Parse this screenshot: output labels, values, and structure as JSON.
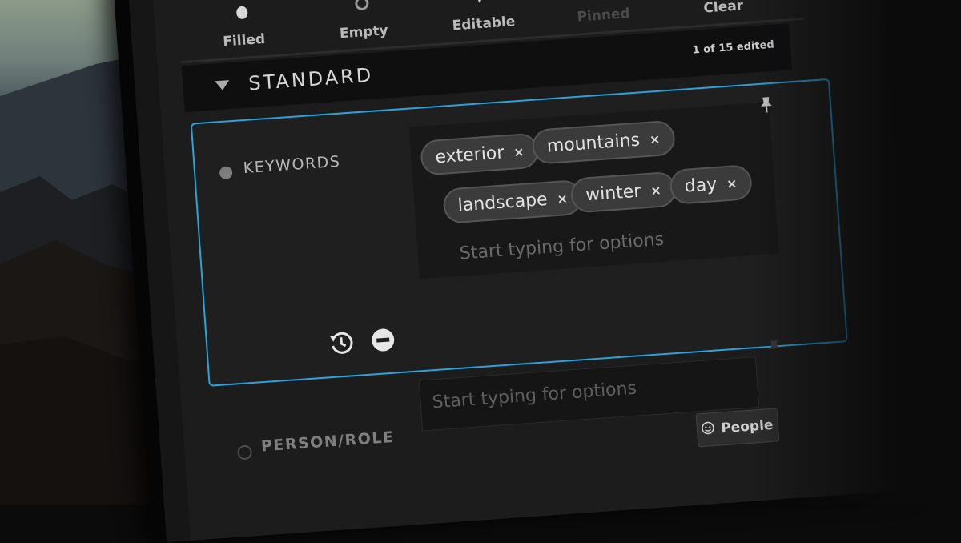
{
  "toolbar": {
    "items": [
      {
        "label": "Filled",
        "icon": "filled-icon"
      },
      {
        "label": "Empty",
        "icon": "empty-circle-icon"
      },
      {
        "label": "Editable",
        "icon": "pencil-icon"
      },
      {
        "label": "Pinned",
        "icon": "pin-icon"
      },
      {
        "label": "Clear",
        "icon": "clear-icon"
      }
    ]
  },
  "section": {
    "title": "STANDARD",
    "count": "1 of 15 edited"
  },
  "keywords": {
    "label": "KEYWORDS",
    "tags": [
      "exterior",
      "mountains",
      "landscape",
      "winter",
      "day"
    ],
    "remove_symbol": "×",
    "placeholder": "Start typing for options"
  },
  "person_role": {
    "label": "PERSON/ROLE",
    "placeholder": "Start typing for options",
    "button_label": "People"
  },
  "colors": {
    "accent": "#2aa3d8",
    "panel": "#1f1f20",
    "tag_bg": "#3b3b3c"
  }
}
